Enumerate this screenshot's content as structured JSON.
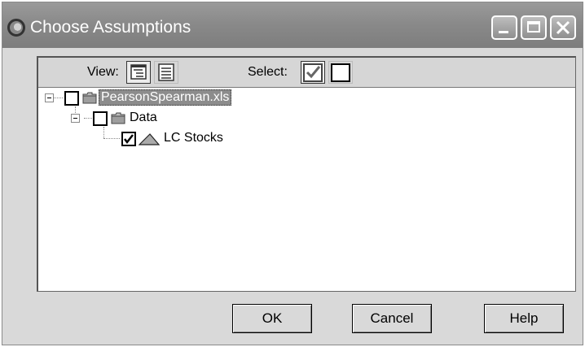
{
  "window": {
    "title": "Choose Assumptions"
  },
  "toolbar": {
    "view_label": "View:",
    "select_label": "Select:"
  },
  "tree": {
    "items": [
      {
        "label": "PearsonSpearman.xls",
        "checked": false,
        "icon": "folder-icon",
        "selected": true
      },
      {
        "label": "Data",
        "checked": false,
        "icon": "folder-icon",
        "selected": false
      },
      {
        "label": "LC Stocks",
        "checked": true,
        "icon": "triangle-distribution-icon",
        "selected": false
      }
    ]
  },
  "buttons": {
    "ok": "OK",
    "cancel": "Cancel",
    "help": "Help"
  }
}
